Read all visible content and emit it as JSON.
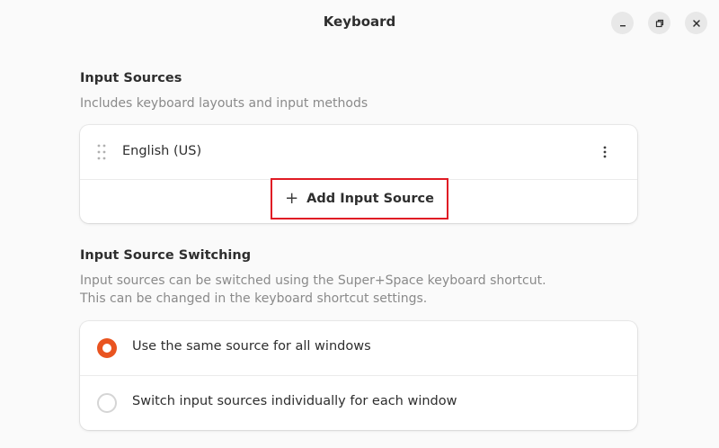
{
  "window": {
    "title": "Keyboard",
    "controls": [
      "minimize-icon",
      "maximize-icon",
      "close-icon"
    ]
  },
  "input_sources": {
    "title": "Input Sources",
    "description": "Includes keyboard layouts and input methods",
    "items": [
      {
        "label": "English (US)",
        "icon": "drag-handle-icon",
        "menu_icon": "more-vertical-icon"
      }
    ],
    "add_button": {
      "icon": "plus-icon",
      "label": "Add Input Source"
    }
  },
  "switching": {
    "title": "Input Source Switching",
    "description_line1": "Input sources can be switched using the Super+Space keyboard shortcut.",
    "description_line2": "This can be changed in the keyboard shortcut settings.",
    "options": [
      {
        "label": "Use the same source for all windows",
        "selected": true
      },
      {
        "label": "Switch input sources individually for each window",
        "selected": false
      }
    ]
  },
  "colors": {
    "accent": "#e95420",
    "highlight_border": "#e01b24"
  }
}
